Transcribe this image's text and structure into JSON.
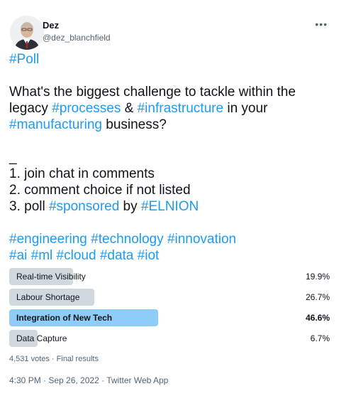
{
  "author": {
    "name": "Dez",
    "handle": "@dez_blanchfield"
  },
  "more_glyph": "•••",
  "tweet": {
    "line1_tag": "#Poll",
    "q_part1": "What's the biggest challenge to tackle within the legacy ",
    "q_tag1": "#processes",
    "q_part2": " & ",
    "q_tag2": "#infrastructure",
    "q_part3": " in your ",
    "q_tag3": "#manufacturing",
    "q_part4": " business?",
    "underscore": "_",
    "item1": "1. join chat in comments",
    "item2": "2. comment choice if not listed",
    "item3_part1": "3. poll ",
    "item3_tag1": "#sponsored",
    "item3_part2": " by ",
    "item3_tag2": "#ELNION",
    "hashtags_line1": [
      "#engineering",
      "#technology",
      "#innovation"
    ],
    "hashtags_line2": [
      "#ai",
      "#ml",
      "#cloud",
      "#data",
      "#iot"
    ]
  },
  "poll": {
    "options": [
      {
        "label": "Real-time Visibility",
        "percent_text": "19.9%",
        "percent": 19.9,
        "winner": false
      },
      {
        "label": "Labour Shortage",
        "percent_text": "26.7%",
        "percent": 26.7,
        "winner": false
      },
      {
        "label": "Integration of New Tech",
        "percent_text": "46.6%",
        "percent": 46.6,
        "winner": true
      },
      {
        "label": "Data Capture",
        "percent_text": "6.7%",
        "percent": 6.7,
        "winner": false
      }
    ],
    "meta": "4,531 votes · Final results"
  },
  "timestamp": "4:30 PM · Sep 26, 2022 · Twitter Web App",
  "colors": {
    "link": "#1d9bf0",
    "bar": "#cfd9de",
    "bar_winner": "#8ecdf8",
    "muted": "#536471"
  }
}
